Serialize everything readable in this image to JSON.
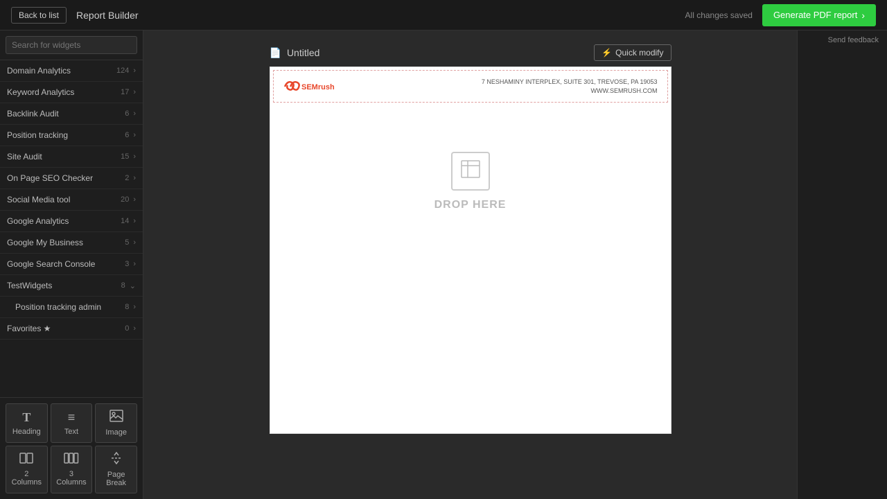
{
  "topbar": {
    "back_button_label": "Back to list",
    "title": "Report Builder",
    "saved_text": "All changes saved",
    "generate_button_label": "Generate PDF report"
  },
  "sidebar": {
    "search_placeholder": "Search for widgets",
    "items": [
      {
        "id": "domain-analytics",
        "label": "Domain Analytics",
        "count": "124",
        "has_chevron": true
      },
      {
        "id": "keyword-analytics",
        "label": "Keyword Analytics",
        "count": "17",
        "has_chevron": true
      },
      {
        "id": "backlink-audit",
        "label": "Backlink Audit",
        "count": "6",
        "has_chevron": true
      },
      {
        "id": "position-tracking",
        "label": "Position tracking",
        "count": "6",
        "has_chevron": true
      },
      {
        "id": "site-audit",
        "label": "Site Audit",
        "count": "15",
        "has_chevron": true
      },
      {
        "id": "on-page-seo-checker",
        "label": "On Page SEO Checker",
        "count": "2",
        "has_chevron": true
      },
      {
        "id": "social-media-tool",
        "label": "Social Media tool",
        "count": "20",
        "has_chevron": true
      },
      {
        "id": "google-analytics",
        "label": "Google Analytics",
        "count": "14",
        "has_chevron": true
      },
      {
        "id": "google-my-business",
        "label": "Google My Business",
        "count": "5",
        "has_chevron": true
      },
      {
        "id": "google-search-console",
        "label": "Google Search Console",
        "count": "3",
        "has_chevron": true
      },
      {
        "id": "test-widgets",
        "label": "TestWidgets",
        "count": "8",
        "has_chevron": true,
        "expanded": true
      },
      {
        "id": "position-tracking-admin",
        "label": "Position tracking admin",
        "count": "8",
        "has_chevron": true,
        "sub": true
      },
      {
        "id": "favorites",
        "label": "Favorites ★",
        "count": "0",
        "has_chevron": true
      }
    ],
    "tools": [
      {
        "id": "heading",
        "label": "Heading",
        "icon": "T"
      },
      {
        "id": "text",
        "label": "Text",
        "icon": "≡"
      },
      {
        "id": "image",
        "label": "Image",
        "icon": "🖼"
      },
      {
        "id": "two-columns",
        "label": "2 Columns",
        "icon": "⊟"
      },
      {
        "id": "three-columns",
        "label": "3 Columns",
        "icon": "⊞"
      },
      {
        "id": "page-break",
        "label": "Page Break",
        "icon": "✂"
      }
    ]
  },
  "report": {
    "doc_icon": "📄",
    "title": "Untitled",
    "quick_modify_label": "Quick modify",
    "lightning_icon": "⚡",
    "canvas": {
      "logo_text": "SEMRUSH",
      "address_line1": "7 NESHAMINY INTERPLEX, SUITE 301, TREVOSE, PA 19053",
      "address_line2": "WWW.SEMRUSH.COM",
      "drop_text": "DROP HERE"
    }
  },
  "right_panel": {
    "send_feedback_label": "Send feedback"
  }
}
